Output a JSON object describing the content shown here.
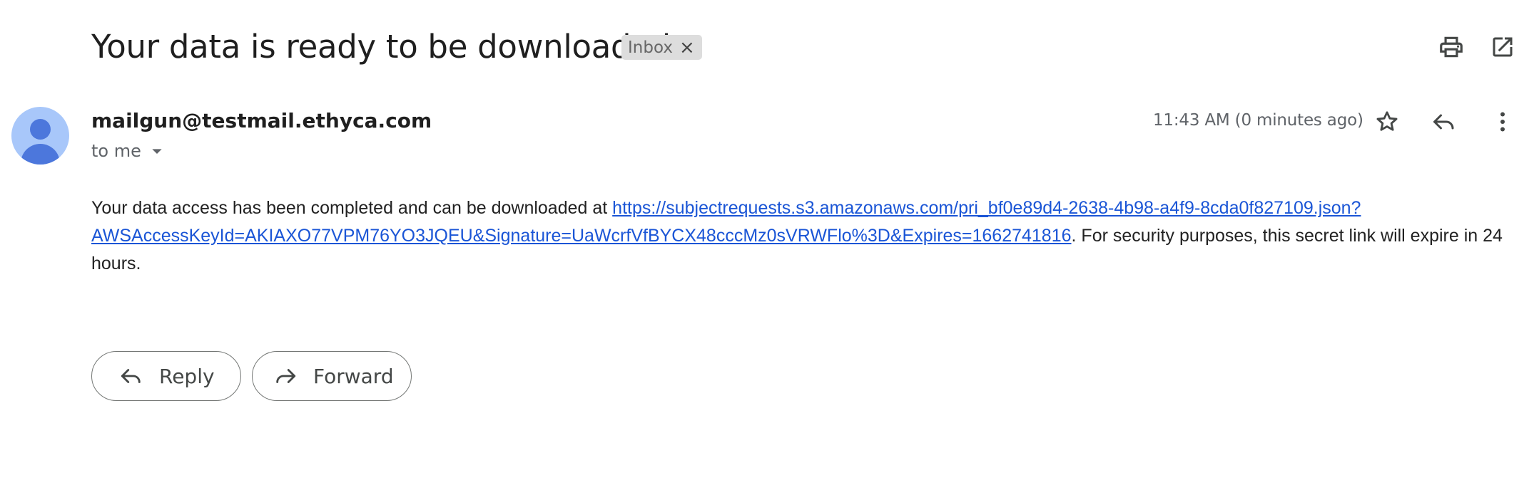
{
  "email": {
    "subject": "Your data is ready to be downloaded",
    "label": "Inbox",
    "label_remove": "×",
    "sender": "mailgun@testmail.ethyca.com",
    "recipient": "to me",
    "timestamp": "11:43 AM (0 minutes ago)",
    "body_prefix": "Your data access has been completed and can be downloaded at ",
    "link_line1": "https://subjectrequests.s3.amazonaws.com/pri_bf0e89d4-2638-4b98-a4f9-8cda0f827109.json?",
    "link_line2": "AWSAccessKeyId=AKIAXO77VPM76YO3JQEU&Signature=UaWcrfVfBYCX48cccMz0sVRWFlo%3D&Expires=1662741816",
    "body_suffix": ". For security purposes, this secret link will expire in 24 hours."
  },
  "actions": {
    "reply_label": "Reply",
    "forward_label": "Forward"
  },
  "icons": {
    "print": "print-icon",
    "open_new_window": "open-in-new-window-icon",
    "star": "star-icon",
    "reply": "reply-icon",
    "more": "more-vert-icon",
    "forward": "forward-icon",
    "dropdown": "arrow-drop-down-icon"
  },
  "colors": {
    "link": "#1a55d6",
    "avatar_bg": "#a8c7fa",
    "avatar_fg": "#4c77dc",
    "chip_bg": "#dddddd"
  }
}
